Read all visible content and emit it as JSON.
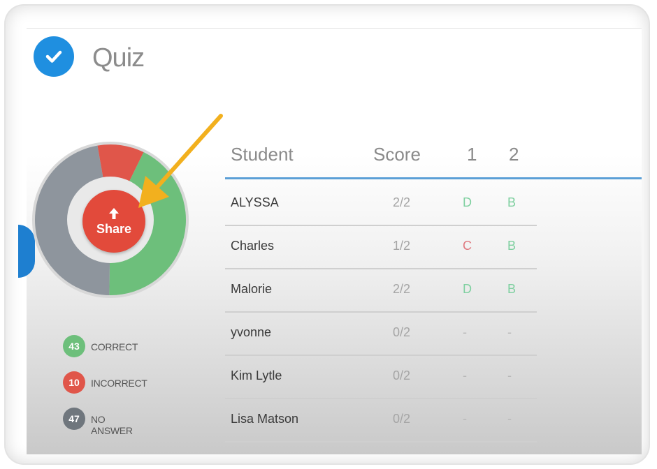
{
  "header": {
    "title": "Quiz",
    "check_icon": "check-icon",
    "accent": "#1f8fe0"
  },
  "chart_data": {
    "type": "pie",
    "slices": [
      {
        "label": "CORRECT",
        "value": 43,
        "color": "#6dbf7b"
      },
      {
        "label": "INCORRECT",
        "value": 10,
        "color": "#e0564a"
      },
      {
        "label": "NO ANSWER",
        "value": 47,
        "color": "#8e959d"
      }
    ]
  },
  "share": {
    "label": "Share",
    "icon": "upload-arrow-icon",
    "color": "#e24a3b"
  },
  "table": {
    "columns": [
      "Student",
      "Score",
      "1",
      "2"
    ],
    "rows": [
      {
        "name": "ALYSSA",
        "score": "2/2",
        "q1": "D",
        "q1_status": "correct",
        "q2": "B",
        "q2_status": "correct"
      },
      {
        "name": "Charles",
        "score": "1/2",
        "q1": "C",
        "q1_status": "incorrect",
        "q2": "B",
        "q2_status": "correct"
      },
      {
        "name": "Malorie",
        "score": "2/2",
        "q1": "D",
        "q1_status": "correct",
        "q2": "B",
        "q2_status": "correct"
      },
      {
        "name": "yvonne",
        "score": "0/2",
        "q1": "-",
        "q1_status": "none",
        "q2": "-",
        "q2_status": "none"
      },
      {
        "name": "Kim Lytle",
        "score": "0/2",
        "q1": "-",
        "q1_status": "none",
        "q2": "-",
        "q2_status": "none"
      },
      {
        "name": "Lisa Matson",
        "score": "0/2",
        "q1": "-",
        "q1_status": "none",
        "q2": "-",
        "q2_status": "none"
      }
    ]
  },
  "legend": [
    {
      "count": "43",
      "label": "CORRECT",
      "color": "#6dbf7b"
    },
    {
      "count": "10",
      "label": "INCORRECT",
      "color": "#e0564a"
    },
    {
      "count": "47",
      "label": "NO ANSWER",
      "color": "#6f767d"
    }
  ],
  "status_colors": {
    "correct": "#7fd0a0",
    "incorrect": "#e07a80",
    "none": "#b8b8b8"
  },
  "annotation": {
    "icon": "pointer-arrow-icon",
    "color": "#f2b01e"
  }
}
